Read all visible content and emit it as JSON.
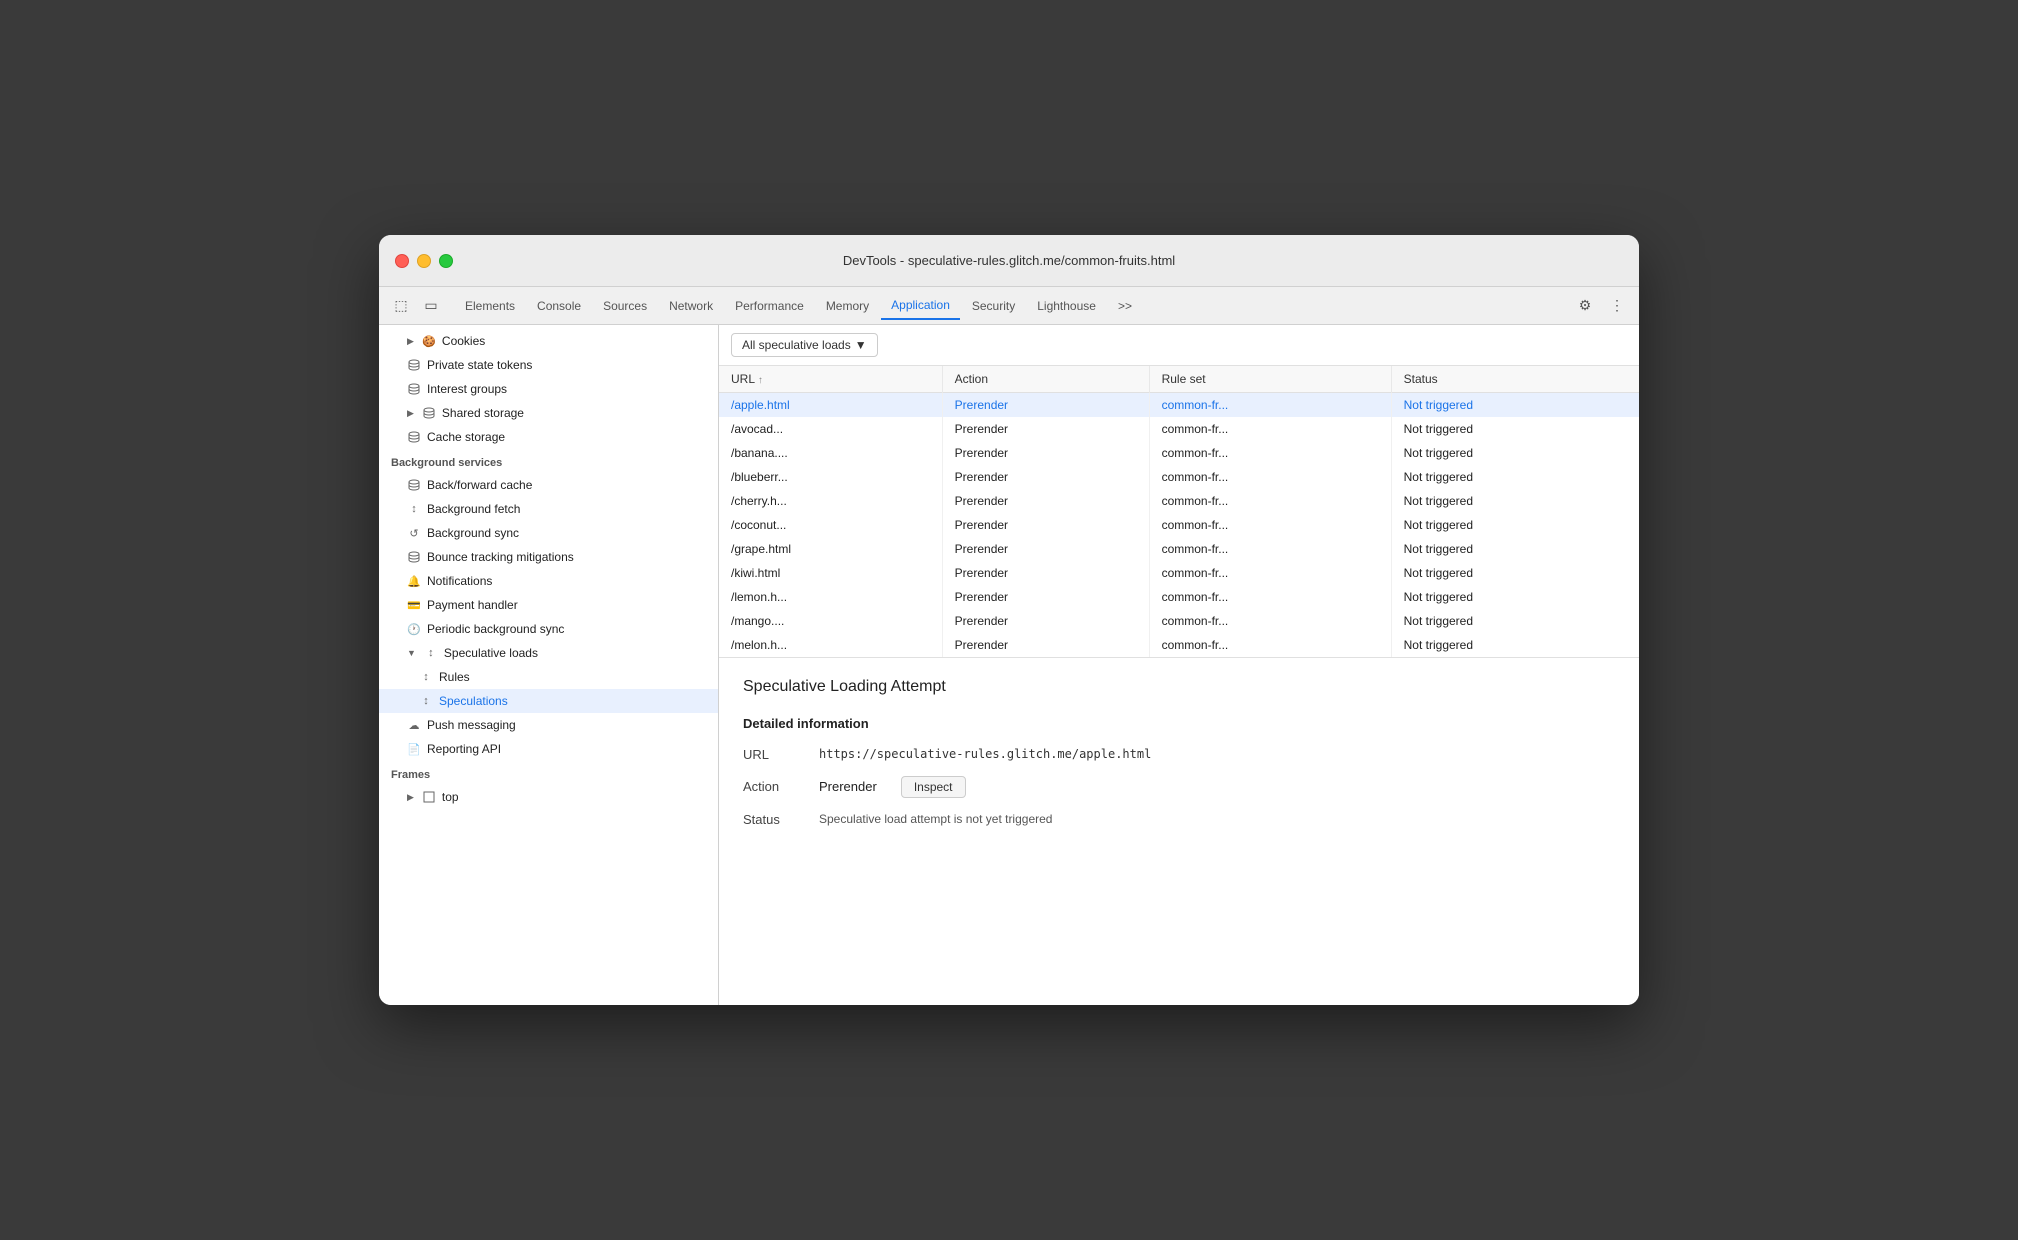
{
  "window": {
    "title": "DevTools - speculative-rules.glitch.me/common-fruits.html"
  },
  "tabs": {
    "items": [
      {
        "label": "Elements",
        "active": false
      },
      {
        "label": "Console",
        "active": false
      },
      {
        "label": "Sources",
        "active": false
      },
      {
        "label": "Network",
        "active": false
      },
      {
        "label": "Performance",
        "active": false
      },
      {
        "label": "Memory",
        "active": false
      },
      {
        "label": "Application",
        "active": true
      },
      {
        "label": "Security",
        "active": false
      },
      {
        "label": "Lighthouse",
        "active": false
      },
      {
        "label": ">>",
        "active": false
      }
    ]
  },
  "sidebar": {
    "sections": [
      {
        "items": [
          {
            "label": "Cookies",
            "icon": "cookie",
            "indent": 1,
            "expandable": true
          },
          {
            "label": "Private state tokens",
            "icon": "db",
            "indent": 1
          },
          {
            "label": "Interest groups",
            "icon": "db",
            "indent": 1
          },
          {
            "label": "Shared storage",
            "icon": "db",
            "indent": 1,
            "expandable": true
          },
          {
            "label": "Cache storage",
            "icon": "db",
            "indent": 1
          }
        ]
      },
      {
        "label": "Background services",
        "items": [
          {
            "label": "Back/forward cache",
            "icon": "db",
            "indent": 1
          },
          {
            "label": "Background fetch",
            "icon": "sync",
            "indent": 1
          },
          {
            "label": "Background sync",
            "icon": "sync",
            "indent": 1
          },
          {
            "label": "Bounce tracking mitigations",
            "icon": "db",
            "indent": 1
          },
          {
            "label": "Notifications",
            "icon": "bell",
            "indent": 1
          },
          {
            "label": "Payment handler",
            "icon": "card",
            "indent": 1
          },
          {
            "label": "Periodic background sync",
            "icon": "clock",
            "indent": 1
          },
          {
            "label": "Speculative loads",
            "icon": "sync",
            "indent": 1,
            "expandable": true,
            "expanded": true
          },
          {
            "label": "Rules",
            "icon": "sync",
            "indent": 2
          },
          {
            "label": "Speculations",
            "icon": "sync",
            "indent": 2,
            "selected": true
          },
          {
            "label": "Push messaging",
            "icon": "cloud",
            "indent": 1
          },
          {
            "label": "Reporting API",
            "icon": "doc",
            "indent": 1
          }
        ]
      },
      {
        "label": "Frames",
        "items": [
          {
            "label": "top",
            "icon": "frame",
            "indent": 1,
            "expandable": true
          }
        ]
      }
    ]
  },
  "filter": {
    "label": "All speculative loads",
    "dropdown_icon": "▼"
  },
  "table": {
    "columns": [
      {
        "label": "URL",
        "sorted": true
      },
      {
        "label": "Action"
      },
      {
        "label": "Rule set"
      },
      {
        "label": "Status"
      }
    ],
    "rows": [
      {
        "url": "/apple.html",
        "action": "Prerender",
        "ruleset": "common-fr...",
        "status": "Not triggered",
        "selected": true
      },
      {
        "url": "/avocad...",
        "action": "Prerender",
        "ruleset": "common-fr...",
        "status": "Not triggered",
        "selected": false
      },
      {
        "url": "/banana....",
        "action": "Prerender",
        "ruleset": "common-fr...",
        "status": "Not triggered",
        "selected": false
      },
      {
        "url": "/blueberr...",
        "action": "Prerender",
        "ruleset": "common-fr...",
        "status": "Not triggered",
        "selected": false
      },
      {
        "url": "/cherry.h...",
        "action": "Prerender",
        "ruleset": "common-fr...",
        "status": "Not triggered",
        "selected": false
      },
      {
        "url": "/coconut...",
        "action": "Prerender",
        "ruleset": "common-fr...",
        "status": "Not triggered",
        "selected": false
      },
      {
        "url": "/grape.html",
        "action": "Prerender",
        "ruleset": "common-fr...",
        "status": "Not triggered",
        "selected": false
      },
      {
        "url": "/kiwi.html",
        "action": "Prerender",
        "ruleset": "common-fr...",
        "status": "Not triggered",
        "selected": false
      },
      {
        "url": "/lemon.h...",
        "action": "Prerender",
        "ruleset": "common-fr...",
        "status": "Not triggered",
        "selected": false
      },
      {
        "url": "/mango....",
        "action": "Prerender",
        "ruleset": "common-fr...",
        "status": "Not triggered",
        "selected": false
      },
      {
        "url": "/melon.h...",
        "action": "Prerender",
        "ruleset": "common-fr...",
        "status": "Not triggered",
        "selected": false
      }
    ]
  },
  "detail": {
    "title": "Speculative Loading Attempt",
    "section_title": "Detailed information",
    "url_label": "URL",
    "url_value": "https://speculative-rules.glitch.me/apple.html",
    "action_label": "Action",
    "action_value": "Prerender",
    "inspect_label": "Inspect",
    "status_label": "Status",
    "status_value": "Speculative load attempt is not yet triggered"
  }
}
